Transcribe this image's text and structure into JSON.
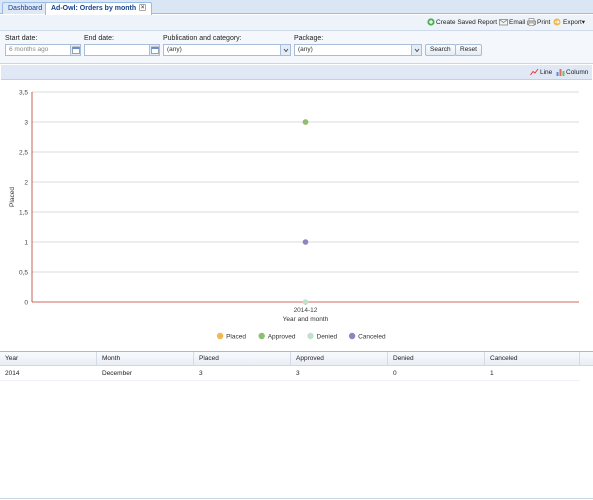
{
  "tabs": [
    {
      "label": "Dashboard",
      "active": false
    },
    {
      "label": "Ad-Owl: Orders by month",
      "active": true,
      "closable": true
    }
  ],
  "toolbar": {
    "create_saved_report": "Create Saved Report",
    "email": "Email",
    "print": "Print",
    "export": "Export"
  },
  "filters": {
    "start_date": {
      "label": "Start date:",
      "value": "6 months ago"
    },
    "end_date": {
      "label": "End date:",
      "value": ""
    },
    "publication": {
      "label": "Publication and category:",
      "value": "(any)"
    },
    "package": {
      "label": "Package:",
      "value": "(any)"
    },
    "search_label": "Search",
    "reset_label": "Reset"
  },
  "chart_toggle": {
    "line_label": "Line",
    "column_label": "Column"
  },
  "chart_data": {
    "type": "scatter",
    "categories": [
      "2014-12"
    ],
    "series": [
      {
        "name": "Placed",
        "values": [
          3
        ],
        "color": "#f6b553"
      },
      {
        "name": "Approved",
        "values": [
          3
        ],
        "color": "#8dbf72"
      },
      {
        "name": "Denied",
        "values": [
          0
        ],
        "color": "#bfe2cc"
      },
      {
        "name": "Canceled",
        "values": [
          1
        ],
        "color": "#8b86c2"
      }
    ],
    "xlabel": "Year and month",
    "ylabel": "Placed",
    "ylim": [
      0,
      3.5
    ],
    "yticks": [
      "0",
      "0,5",
      "1",
      "1,5",
      "2",
      "2,5",
      "3",
      "3,5"
    ],
    "grid": true,
    "legend_position": "bottom"
  },
  "table": {
    "columns": [
      "Year",
      "Month",
      "Placed",
      "Approved",
      "Denied",
      "Canceled"
    ],
    "rows": [
      [
        "2014",
        "December",
        "3",
        "3",
        "0",
        "1"
      ]
    ]
  }
}
